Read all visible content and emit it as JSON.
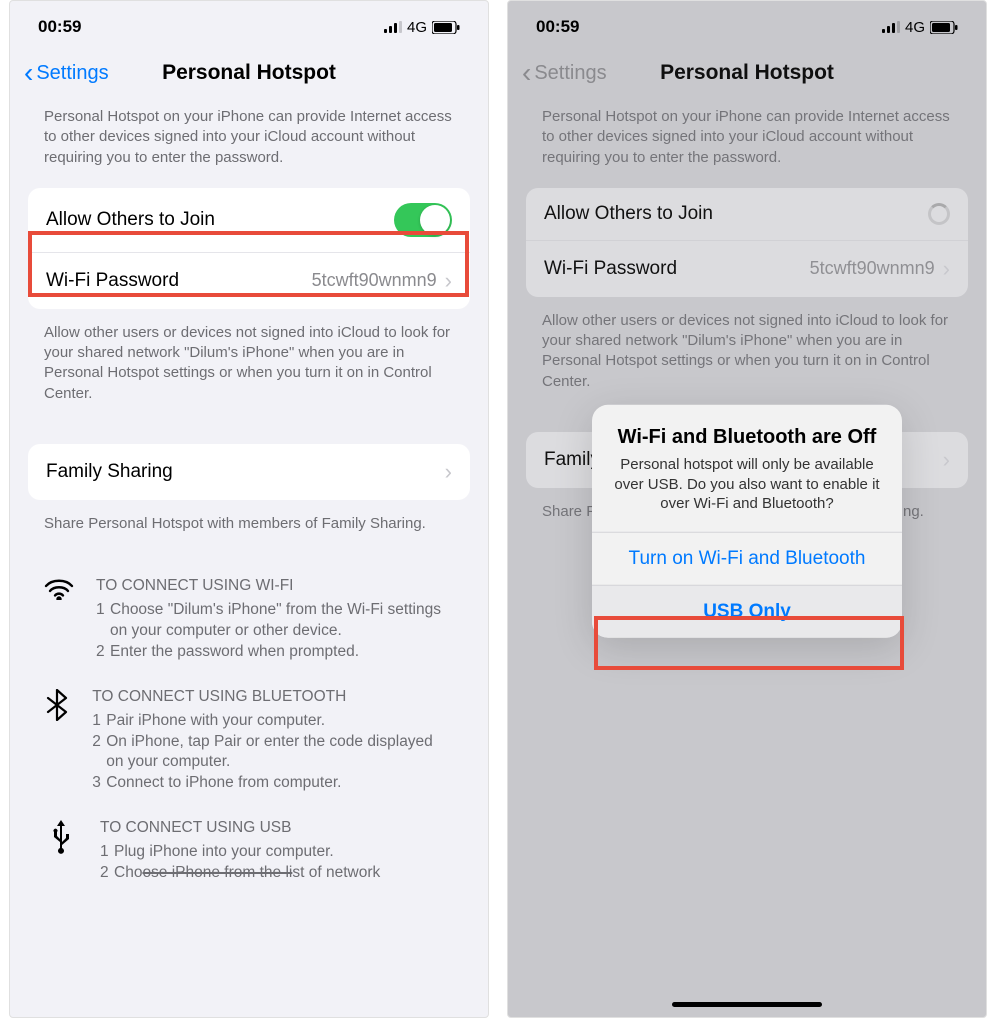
{
  "status": {
    "time": "00:59",
    "network": "4G"
  },
  "nav": {
    "back": "Settings",
    "title": "Personal Hotspot"
  },
  "intro": "Personal Hotspot on your iPhone can provide Internet access to other devices signed into your iCloud account without requiring you to enter the password.",
  "rows": {
    "allow_label": "Allow Others to Join",
    "wifi_pw_label": "Wi-Fi Password",
    "wifi_pw_value": "5tcwft90wnmn9",
    "family_label": "Family Sharing"
  },
  "below_allow": "Allow other users or devices not signed into iCloud to look for your shared network \"Dilum's iPhone\" when you are in Personal Hotspot settings or when you turn it on in Control Center.",
  "below_family": "Share Personal Hotspot with members of Family Sharing.",
  "instr": {
    "wifi": {
      "title": "TO CONNECT USING WI-FI",
      "s1": "Choose \"Dilum's iPhone\" from the Wi-Fi settings on your computer or other device.",
      "s2": "Enter the password when prompted."
    },
    "bt": {
      "title": "TO CONNECT USING BLUETOOTH",
      "s1": "Pair iPhone with your computer.",
      "s2": "On iPhone, tap Pair or enter the code displayed on your computer.",
      "s3": "Connect to iPhone from computer."
    },
    "usb": {
      "title": "TO CONNECT USING USB",
      "s1": "Plug iPhone into your computer.",
      "s2_pre": "Cho",
      "s2_strike": "ose iPhone from the li",
      "s2_post": "st of network"
    }
  },
  "right_short": "Allow other users or devices not signed into iCloud to look for your shared network \"Dilum's iPhone\" when you are in Personal Hotspot settings or when you turn it on in Control Center.",
  "right_family_short": "Share Personal Hotspot with members of Family Sharing.",
  "alert": {
    "title": "Wi-Fi and Bluetooth are Off",
    "msg": "Personal hotspot will only be available over USB. Do you also want to enable it over Wi-Fi and Bluetooth?",
    "btn1": "Turn on Wi-Fi and Bluetooth",
    "btn2": "USB Only"
  }
}
